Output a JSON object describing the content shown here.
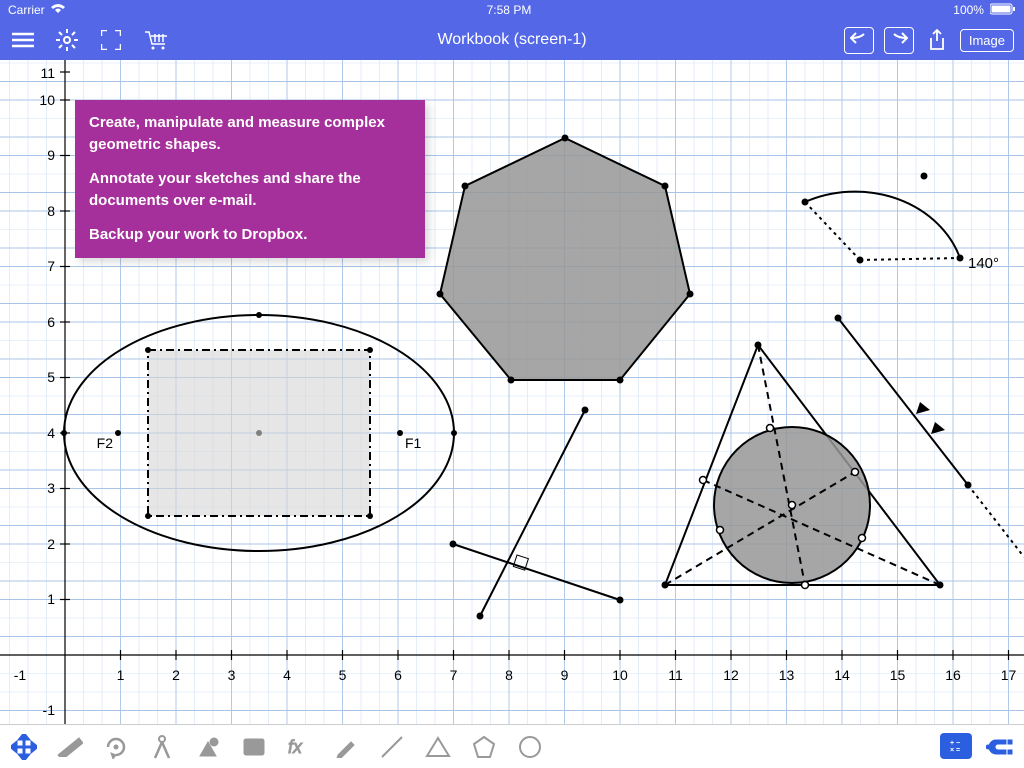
{
  "status": {
    "carrier": "Carrier",
    "time": "7:58 PM",
    "battery": "100%"
  },
  "toolbar": {
    "title": "Workbook (screen-1)",
    "image_btn": "Image"
  },
  "annotation": {
    "l1": "Create, manipulate and measure complex geometric shapes.",
    "l2": "Annotate your sketches and share the documents over e-mail.",
    "l3": "Backup your work to Dropbox."
  },
  "axes": {
    "x": [
      "-1",
      "1",
      "2",
      "3",
      "4",
      "5",
      "6",
      "7",
      "8",
      "9",
      "10",
      "11",
      "12",
      "13",
      "14",
      "15",
      "16",
      "17"
    ],
    "y": [
      "-1",
      "1",
      "2",
      "3",
      "4",
      "5",
      "6",
      "7",
      "8",
      "9",
      "10",
      "11"
    ]
  },
  "labels": {
    "f1": "F1",
    "f2": "F2",
    "angle": "140°"
  }
}
